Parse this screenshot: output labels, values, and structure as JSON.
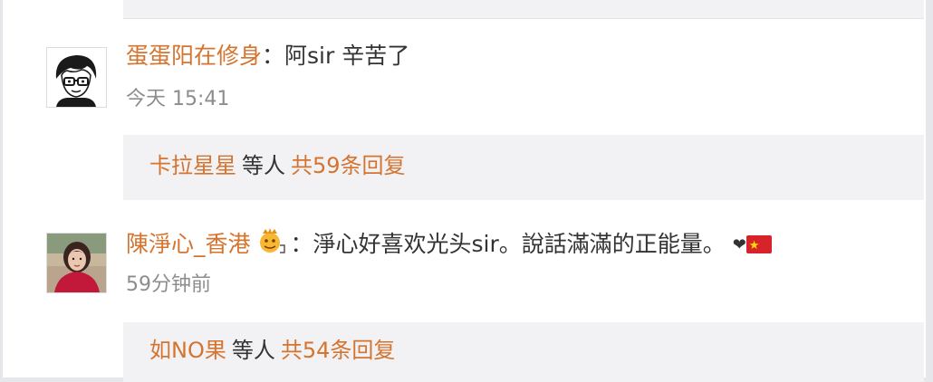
{
  "comments": [
    {
      "username": "蛋蛋阳在修身",
      "colon": "：",
      "text": "阿sir 辛苦了",
      "time": "今天 15:41",
      "avatar_icon": "cartoon-boy-avatar",
      "reply": {
        "name": "卡拉星星",
        "middle": "等人",
        "count": "共59条回复"
      }
    },
    {
      "username": "陳淨心_香港",
      "badge_icon": "crown-emoji-icon",
      "colon": "：",
      "text": "淨心好喜欢光头sir。說話滿滿的正能量。",
      "trailing_icons": [
        "heart-icon",
        "china-flag-icon"
      ],
      "heart_glyph": "❤",
      "time": "59分钟前",
      "avatar_icon": "woman-photo-avatar",
      "reply": {
        "name": "如NO果",
        "middle": "等人",
        "count": "共54条回复"
      }
    }
  ],
  "colors": {
    "username": "#d4742f",
    "text": "#333333",
    "time": "#8d8d8d",
    "reply_bg": "#f2f2f5"
  }
}
